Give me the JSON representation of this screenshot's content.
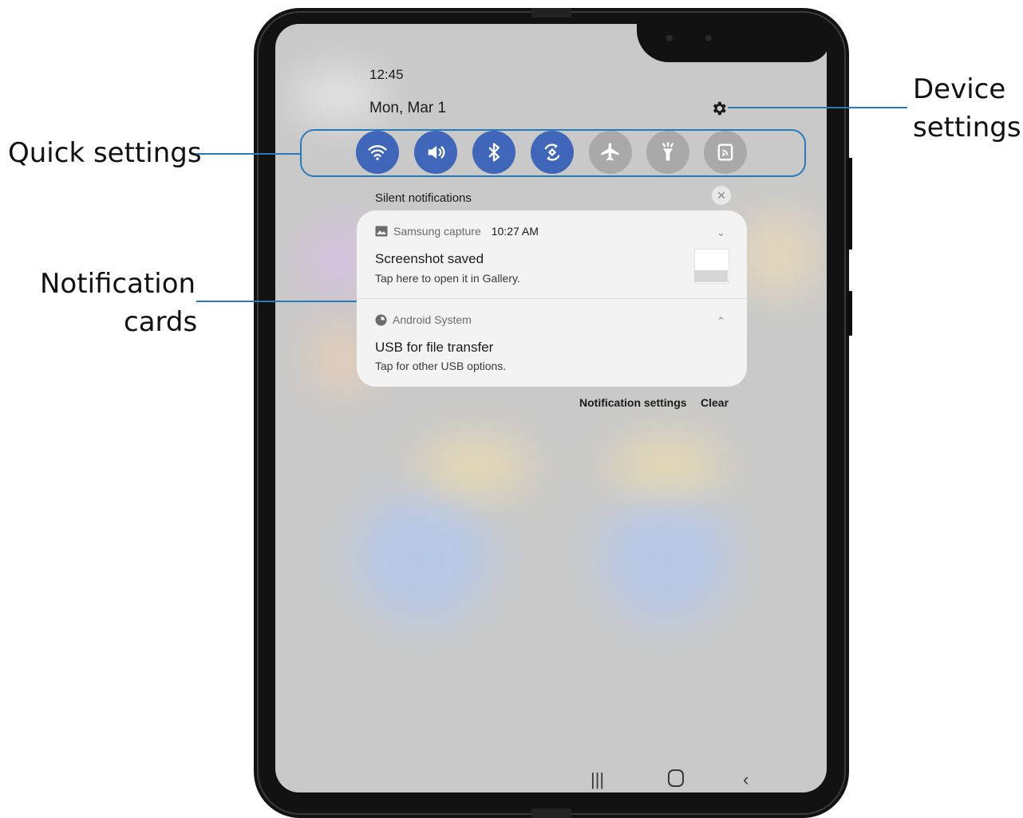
{
  "callouts": {
    "quick_settings": "Quick settings",
    "notification_cards_line1": "Notification",
    "notification_cards_line2": "cards",
    "device_settings_line1": "Device",
    "device_settings_line2": "settings"
  },
  "status": {
    "time": "12:45",
    "date": "Mon, Mar 1"
  },
  "quick_settings": [
    {
      "icon": "wifi-icon",
      "state": "on"
    },
    {
      "icon": "sound-icon",
      "state": "on"
    },
    {
      "icon": "bluetooth-icon",
      "state": "on"
    },
    {
      "icon": "auto-rotate-icon",
      "state": "on"
    },
    {
      "icon": "airplane-mode-icon",
      "state": "off"
    },
    {
      "icon": "flashlight-icon",
      "state": "off"
    },
    {
      "icon": "cast-icon",
      "state": "off"
    }
  ],
  "notifications": {
    "section_label": "Silent notifications",
    "items": [
      {
        "app": "Samsung capture",
        "time": "10:27 AM",
        "title": "Screenshot saved",
        "body": "Tap here to open it in Gallery."
      },
      {
        "app": "Android System",
        "time": "",
        "title": "USB for file transfer",
        "body": "Tap for other USB options."
      }
    ],
    "settings_label": "Notification settings",
    "clear_label": "Clear"
  },
  "colors": {
    "accent": "#3f66b9",
    "callout_line": "#2a7ab8",
    "screen": "#c9c9c9",
    "card": "#f3f3f3"
  }
}
